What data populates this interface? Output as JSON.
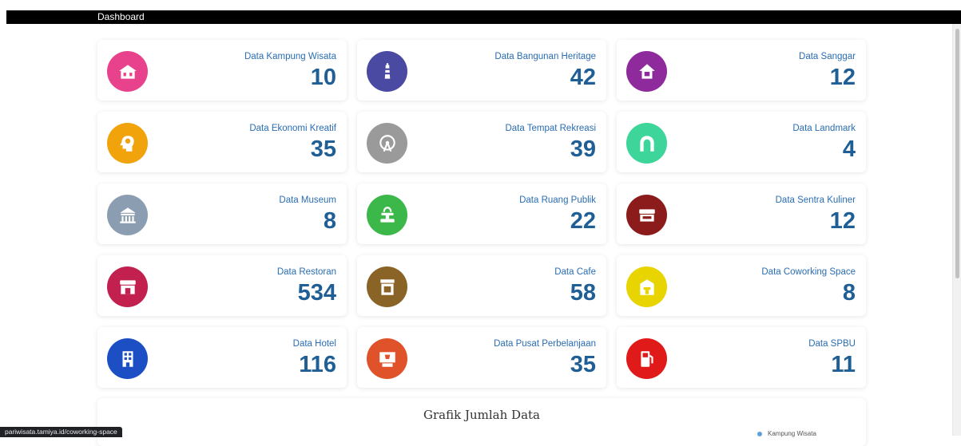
{
  "header": {
    "title": "Dashboard"
  },
  "cards": [
    {
      "label": "Data Kampung Wisata",
      "value": "10",
      "icon": "house-icon",
      "color": "#e8428c"
    },
    {
      "label": "Data Bangunan Heritage",
      "value": "42",
      "icon": "lighthouse-icon",
      "color": "#4a4aa3"
    },
    {
      "label": "Data Sanggar",
      "value": "12",
      "icon": "home-icon",
      "color": "#8e2a9b"
    },
    {
      "label": "Data Ekonomi Kreatif",
      "value": "35",
      "icon": "creative-head-icon",
      "color": "#f0a30a"
    },
    {
      "label": "Data Tempat Rekreasi",
      "value": "39",
      "icon": "ferris-wheel-icon",
      "color": "#9a9a9a"
    },
    {
      "label": "Data Landmark",
      "value": "4",
      "icon": "arch-icon",
      "color": "#3ed59b"
    },
    {
      "label": "Data Museum",
      "value": "8",
      "icon": "museum-icon",
      "color": "#8b9db0"
    },
    {
      "label": "Data Ruang Publik",
      "value": "22",
      "icon": "fountain-icon",
      "color": "#3cb84a"
    },
    {
      "label": "Data Sentra Kuliner",
      "value": "12",
      "icon": "food-stall-icon",
      "color": "#8c1b1b"
    },
    {
      "label": "Data Restoran",
      "value": "534",
      "icon": "restaurant-icon",
      "color": "#c2204f"
    },
    {
      "label": "Data Cafe",
      "value": "58",
      "icon": "cafe-icon",
      "color": "#8a6426"
    },
    {
      "label": "Data Coworking Space",
      "value": "8",
      "icon": "coworking-icon",
      "color": "#e8d400"
    },
    {
      "label": "Data Hotel",
      "value": "116",
      "icon": "hotel-icon",
      "color": "#1d4fc4"
    },
    {
      "label": "Data Pusat Perbelanjaan",
      "value": "35",
      "icon": "shopping-icon",
      "color": "#e0522a"
    },
    {
      "label": "Data SPBU",
      "value": "11",
      "icon": "fuel-pump-icon",
      "color": "#e01919"
    }
  ],
  "chart_section": {
    "title": "Grafik Jumlah Data",
    "legend": [
      {
        "label": "Kampung Wisata",
        "color": "#5fa0d8"
      }
    ]
  },
  "status_bar": {
    "url": "pariwisata.tamiya.id/coworking-space"
  }
}
